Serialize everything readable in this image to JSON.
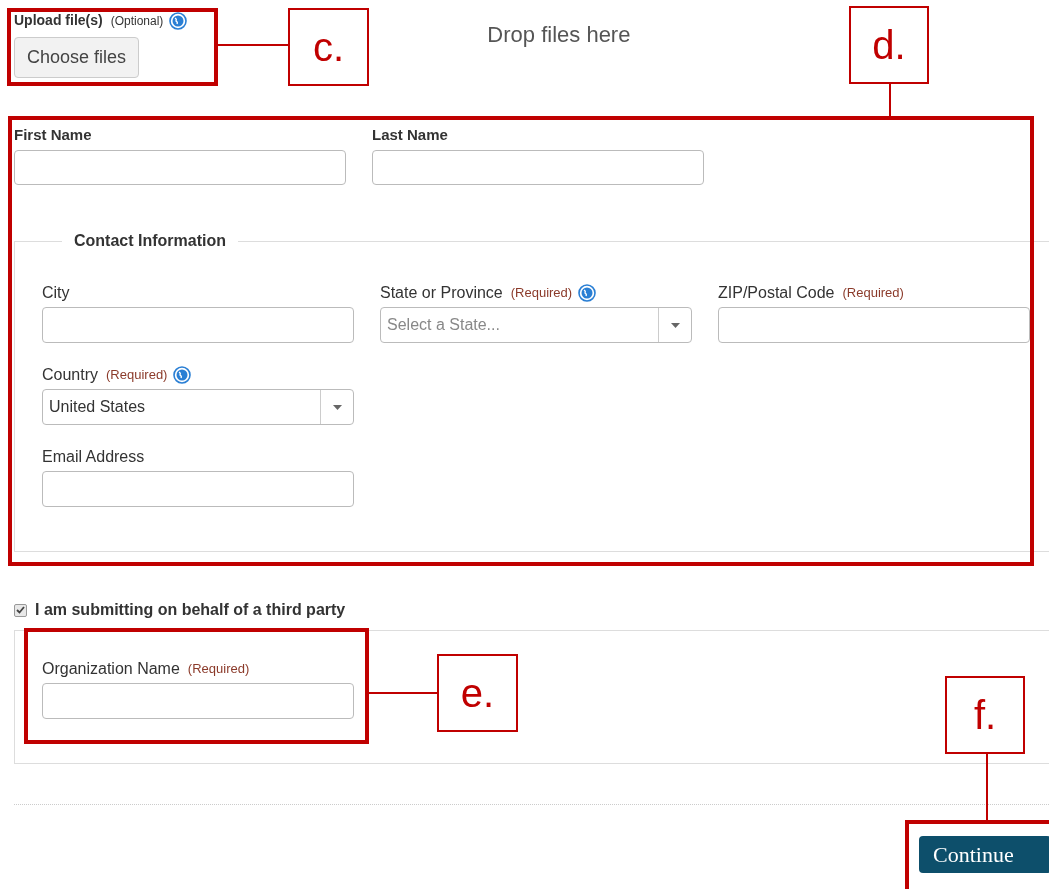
{
  "upload": {
    "label": "Upload file(s)",
    "note": "(Optional)",
    "info": true,
    "button": "Choose files",
    "drop_text": "Drop files here"
  },
  "name_fields": [
    {
      "label": "First Name"
    },
    {
      "label": "Last Name"
    }
  ],
  "contact": {
    "legend": "Contact Information",
    "fields": [
      {
        "kind": "text",
        "label": "City"
      },
      {
        "kind": "select",
        "label": "State or Province",
        "note": "(Required)",
        "info": true,
        "placeholder": "Select a State..."
      },
      {
        "kind": "text",
        "label": "ZIP/Postal Code",
        "note": "(Required)"
      },
      {
        "kind": "select",
        "label": "Country",
        "note": "(Required)",
        "info": true,
        "value": "United States"
      },
      {
        "kind": "text",
        "label": "Email Address"
      }
    ]
  },
  "third_party": {
    "label": "I am submitting on behalf of a third party",
    "checked": true,
    "field": {
      "label": "Organization Name",
      "note": "(Required)"
    }
  },
  "continue_button": "Continue",
  "annotations": [
    {
      "label": "c."
    },
    {
      "label": "d."
    },
    {
      "label": "e."
    },
    {
      "label": "f."
    }
  ]
}
